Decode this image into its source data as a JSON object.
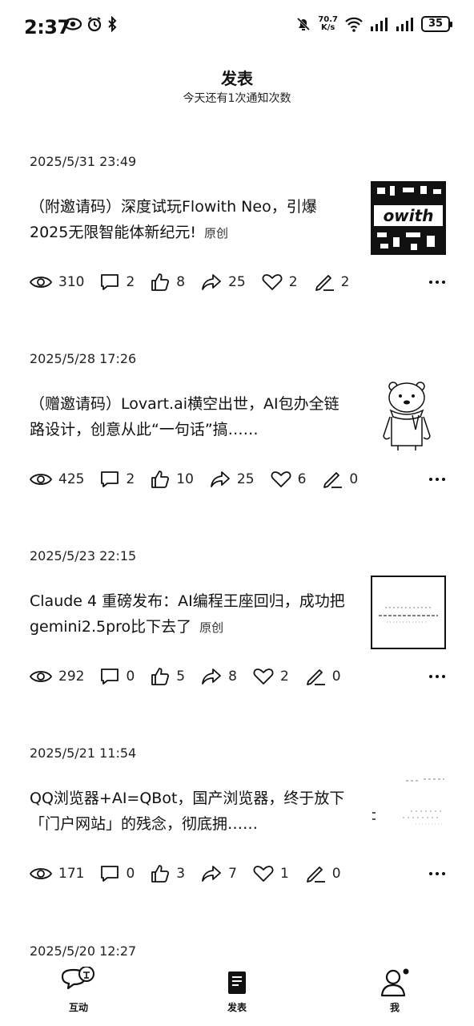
{
  "status_bar": {
    "time": "2:37",
    "net_speed_value": "70.7",
    "net_speed_unit": "K/s",
    "battery": "35"
  },
  "header": {
    "title": "发表",
    "subtitle": "今天还有1次通知次数"
  },
  "articles": [
    {
      "date": "2025/5/31 23:49",
      "title": "（附邀请码）深度试玩Flowith Neo，引爆2025无限智能体新纪元!",
      "badge": "原创",
      "stats": {
        "views": "310",
        "comments": "2",
        "likes": "8",
        "shares": "25",
        "favorites": "2",
        "edits": "2"
      },
      "thumb": "flowith-pixel-art"
    },
    {
      "date": "2025/5/28 17:26",
      "title": "（赠邀请码）Lovart.ai横空出世，AI包办全链路设计，创意从此“一句话”搞……",
      "badge": "",
      "stats": {
        "views": "425",
        "comments": "2",
        "likes": "10",
        "shares": "25",
        "favorites": "6",
        "edits": "0"
      },
      "thumb": "bear-illustration"
    },
    {
      "date": "2025/5/23 22:15",
      "title": "Claude 4 重磅发布：AI编程王座回归，成功把gemini2.5pro比下去了",
      "badge": "原创",
      "stats": {
        "views": "292",
        "comments": "0",
        "likes": "5",
        "shares": "8",
        "favorites": "2",
        "edits": "0"
      },
      "thumb": "bordered-screenshot"
    },
    {
      "date": "2025/5/21 11:54",
      "title": "QQ浏览器+AI=QBot，国产浏览器，终于放下「门户网站」的残念，彻底拥……",
      "badge": "",
      "stats": {
        "views": "171",
        "comments": "0",
        "likes": "3",
        "shares": "7",
        "favorites": "1",
        "edits": "0"
      },
      "thumb": "faint-screenshot"
    }
  ],
  "partial_article_date": "2025/5/20 12:27",
  "bottom_nav": {
    "items": [
      {
        "label": "互动",
        "icon": "chat-bubble-icon"
      },
      {
        "label": "发表",
        "icon": "document-icon"
      },
      {
        "label": "我",
        "icon": "person-icon"
      }
    ]
  }
}
